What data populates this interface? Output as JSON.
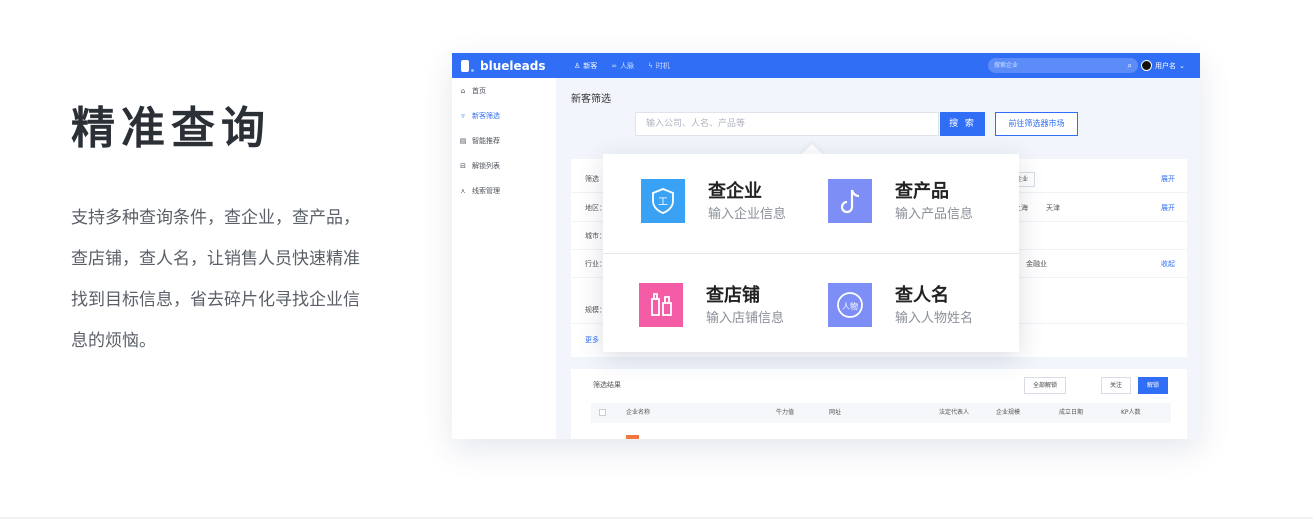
{
  "intro": {
    "title": "精准查询",
    "description": "支持多种查询条件，查企业，查产品，查店铺，查人名，让销售人员快速精准找到目标信息，省去碎片化寻找企业信息的烦恼。"
  },
  "app": {
    "brand": "blueleads",
    "topnav": [
      {
        "label": "新客",
        "icon": "user-icon"
      },
      {
        "label": "人脉",
        "icon": "link-icon"
      },
      {
        "label": "时机",
        "icon": "bolt-icon"
      }
    ],
    "top_search_placeholder": "搜索企业",
    "user_name": "用户名",
    "sidebar": [
      {
        "label": "首页",
        "icon": "home-icon"
      },
      {
        "label": "新客筛选",
        "icon": "filter-icon"
      },
      {
        "label": "智能推荐",
        "icon": "recommend-icon"
      },
      {
        "label": "解锁列表",
        "icon": "unlock-list-icon"
      },
      {
        "label": "线索管理",
        "icon": "leads-icon"
      }
    ],
    "page_title": "新客筛选",
    "search_placeholder": "输入公司、人名、产品等",
    "search_button": "搜 索",
    "market_button": "前往筛选器市场",
    "filters": {
      "row1_label": "筛选",
      "row1_chip": "有海外企业",
      "row1_action": "展开",
      "row2_label": "地区：",
      "row2_opt1": "上海",
      "row2_opt2": "天津",
      "row2_action": "展开",
      "row3_label": "城市：",
      "row4_label": "行业：",
      "row4_opt": "金融业",
      "row4_action": "收起",
      "row5_label": "规模：",
      "more": "更多"
    },
    "results": {
      "title": "筛选结果",
      "unlock_all": "全部解锁",
      "follow": "关注",
      "unlock": "解锁",
      "columns": [
        "企业名称",
        "牛力值",
        "网址",
        "法定代表人",
        "企业规模",
        "成立日期",
        "KP人数"
      ]
    }
  },
  "popup": {
    "items": [
      {
        "title": "查企业",
        "subtitle": "输入企业信息",
        "icon": "shield-company-icon",
        "color": "#3aa2f5"
      },
      {
        "title": "查产品",
        "subtitle": "输入产品信息",
        "icon": "music-note-icon",
        "color": "#7d8ef7"
      },
      {
        "title": "查店铺",
        "subtitle": "输入店铺信息",
        "icon": "bottles-icon",
        "color": "#f45ca5"
      },
      {
        "title": "查人名",
        "subtitle": "输入人物姓名",
        "icon": "person-badge-icon",
        "color": "#7d8ef7"
      }
    ],
    "person_badge_text": "人物",
    "company_badge_text": "工"
  }
}
